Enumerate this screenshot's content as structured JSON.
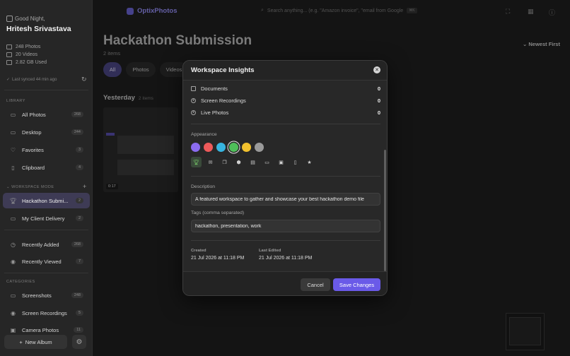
{
  "sidebar": {
    "greeting": "Good Night,",
    "user_name": "Hritesh Srivastava",
    "stats": [
      "248 Photos",
      "20 Videos",
      "2.82 GB Used"
    ],
    "sync_text": "Last synced 44 min ago",
    "library_label": "LIBRARY",
    "library_items": [
      {
        "label": "All Photos",
        "count": "268"
      },
      {
        "label": "Desktop",
        "count": "244"
      },
      {
        "label": "Favorites",
        "count": "3"
      },
      {
        "label": "Clipboard",
        "count": "4"
      }
    ],
    "workspace_label": "WORKSPACE MODE",
    "workspace_items": [
      {
        "label": "Hackathon Submi...",
        "count": "2"
      },
      {
        "label": "My Client Delivery",
        "count": "2"
      }
    ],
    "recent_items": [
      {
        "label": "Recently Added",
        "count": "268"
      },
      {
        "label": "Recently Viewed",
        "count": "7"
      }
    ],
    "categories_label": "CATEGORIES",
    "category_items": [
      {
        "label": "Screenshots",
        "count": "248"
      },
      {
        "label": "Screen Recordings",
        "count": "5"
      },
      {
        "label": "Camera Photos",
        "count": "11"
      }
    ],
    "new_album": "New Album"
  },
  "topbar": {
    "brand": "OptixPhotos",
    "search_placeholder": "Search anything... (e.g. \"Amazon invoice\", \"email from Google",
    "search_kbd": "⌘K"
  },
  "main": {
    "title": "Hackathon Submission",
    "subtitle": "2 items",
    "sort": "Newest First",
    "chips": [
      "All",
      "Photos",
      "Videos"
    ],
    "day_label": "Yesterday",
    "day_count": "2 items",
    "thumb_badge": "0:17"
  },
  "modal": {
    "title": "Workspace Insights",
    "counts": [
      {
        "label": "Documents",
        "value": "0"
      },
      {
        "label": "Screen Recordings",
        "value": "0"
      },
      {
        "label": "Live Photos",
        "value": "0"
      }
    ],
    "appearance_label": "Appearance",
    "colors": [
      "#8b6cf0",
      "#ee5a5a",
      "#37b5e0",
      "#4fbf5a",
      "#f2c12e",
      "#9a9a9a"
    ],
    "selected_color_index": 3,
    "icons": [
      "trophy-icon",
      "mail-icon",
      "stack-icon",
      "box-icon",
      "document-icon",
      "folder-icon",
      "archive-icon",
      "file-icon",
      "star-icon"
    ],
    "selected_icon_index": 0,
    "description_label": "Description",
    "description_value": "A featured workspace to gather and showcase your best hackathon demo file",
    "tags_label": "Tags (comma separated)",
    "tags_value": "hackathon, presentation, work",
    "created_label": "Created",
    "created_value": "21 Jul 2026 at 11:18 PM",
    "edited_label": "Last Edited",
    "edited_value": "21 Jul 2026 at 11:18 PM",
    "cancel": "Cancel",
    "save": "Save Changes"
  }
}
